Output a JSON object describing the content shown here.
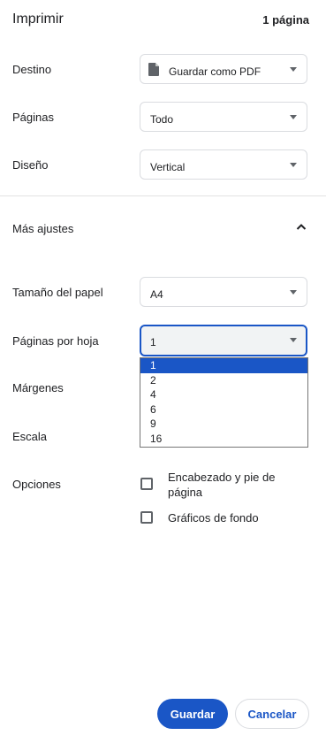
{
  "header": {
    "title": "Imprimir",
    "page_count": "1 página"
  },
  "settings": {
    "destination": {
      "label": "Destino",
      "value": "Guardar como PDF",
      "icon": "document-icon"
    },
    "pages": {
      "label": "Páginas",
      "value": "Todo"
    },
    "layout": {
      "label": "Diseño",
      "value": "Vertical"
    }
  },
  "more_settings": {
    "label": "Más ajustes",
    "icon": "chevron-up-icon",
    "expanded": true
  },
  "advanced": {
    "paper_size": {
      "label": "Tamaño del papel",
      "value": "A4"
    },
    "pages_per_sheet": {
      "label": "Páginas por hoja",
      "value": "1",
      "options": [
        "1",
        "2",
        "4",
        "6",
        "9",
        "16"
      ],
      "selected_index": 0,
      "open": true
    },
    "margins": {
      "label": "Márgenes"
    },
    "scale": {
      "label": "Escala"
    },
    "options": {
      "label": "Opciones",
      "items": [
        {
          "label": "Encabezado y pie de página",
          "checked": false
        },
        {
          "label": "Gráficos de fondo",
          "checked": false
        }
      ]
    }
  },
  "footer": {
    "save_label": "Guardar",
    "cancel_label": "Cancelar"
  },
  "colors": {
    "accent": "#1a56c6",
    "border": "#dadce0",
    "text": "#202124"
  }
}
